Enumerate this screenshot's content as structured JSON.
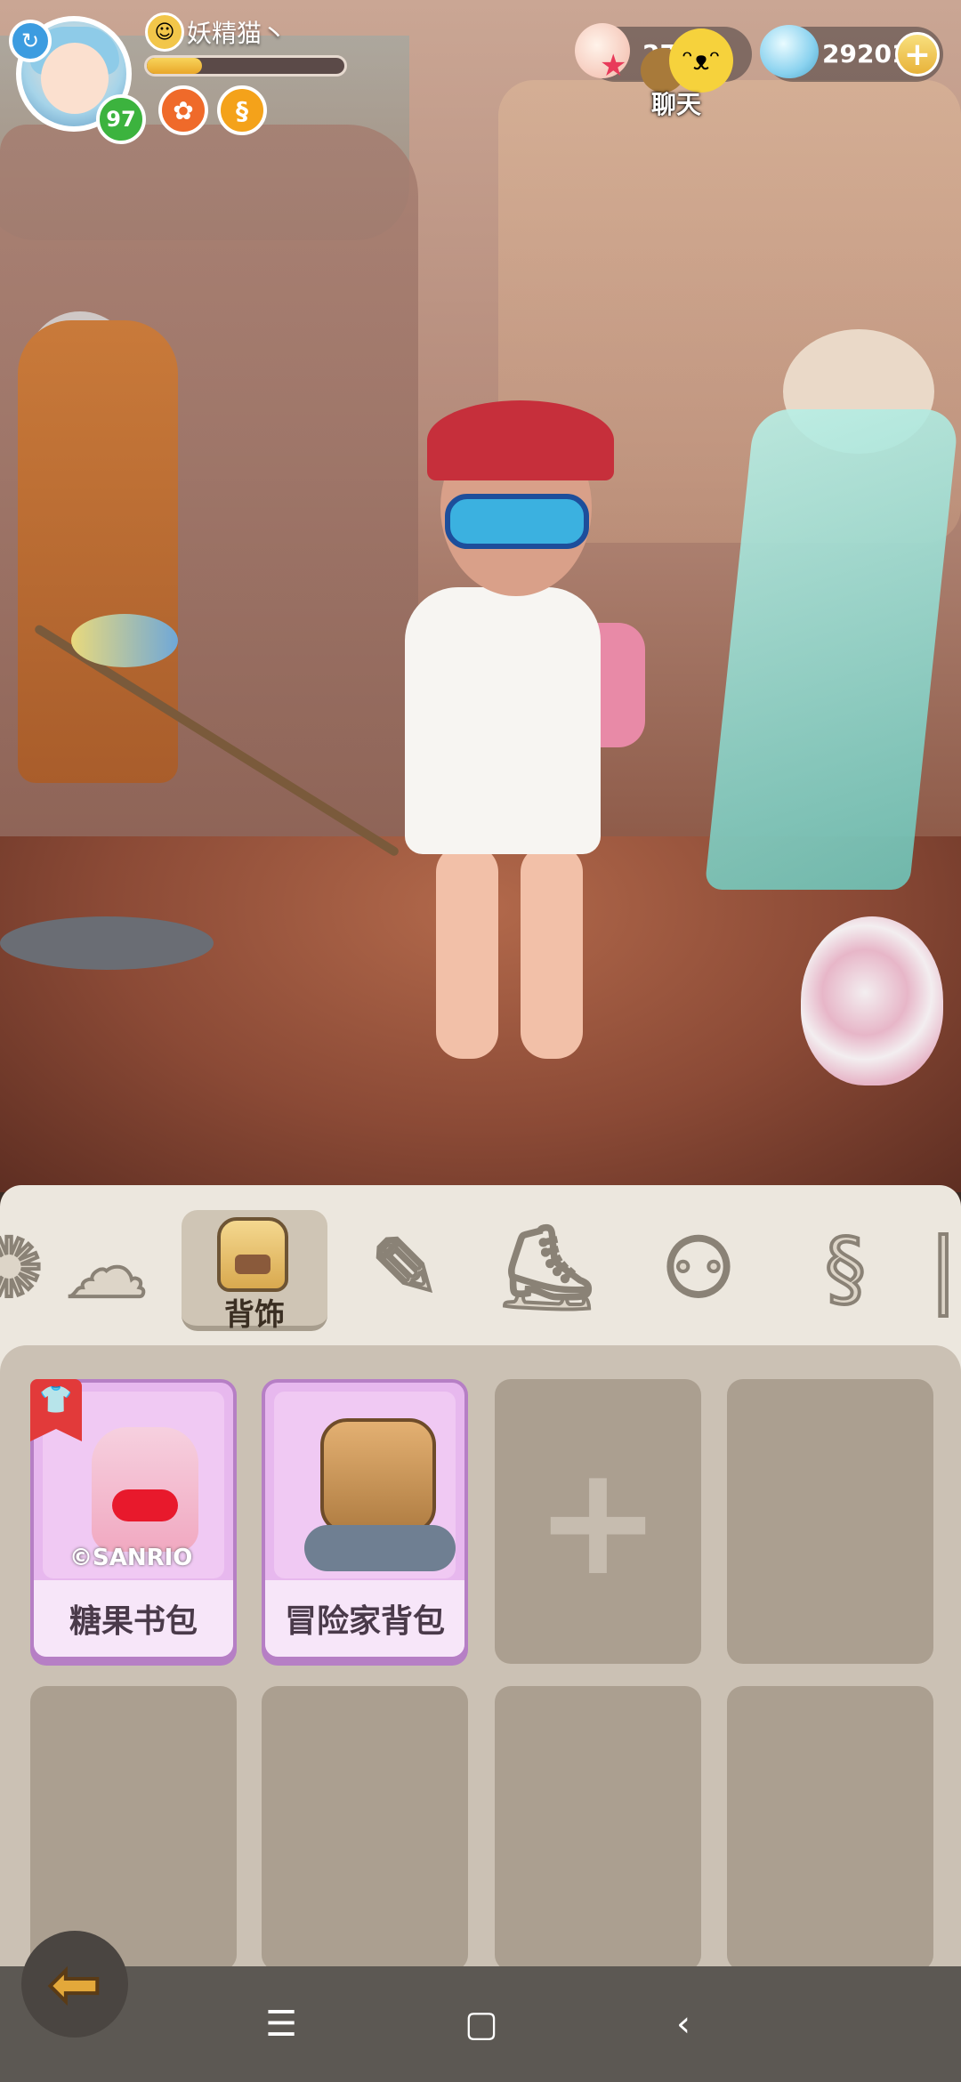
{
  "player": {
    "name": "妖精猫丶",
    "level": "97",
    "xp_fraction": 0.28
  },
  "currencies": [
    {
      "icon": "shell-icon",
      "amount": "27"
    },
    {
      "icon": "gem-icon",
      "amount": "29201"
    }
  ],
  "chat": {
    "label": "聊天"
  },
  "tabs": [
    {
      "icon": "hair-icon",
      "label": ""
    },
    {
      "icon": "backpack-icon",
      "label": "背饰",
      "selected": true
    },
    {
      "icon": "handheld-icon",
      "label": ""
    },
    {
      "icon": "shoes-icon",
      "label": ""
    },
    {
      "icon": "glasses-icon",
      "label": ""
    },
    {
      "icon": "tail-icon",
      "label": ""
    }
  ],
  "items": [
    {
      "name": "糖果书包",
      "watermark": "©SANRIO",
      "tag": "clothing-tag-icon"
    },
    {
      "name": "冒险家背包"
    }
  ],
  "colors": {
    "card_bg": "#e7b8ee",
    "card_border": "#b67fc5",
    "level_badge": "#3cb33e",
    "tag_red": "#e23a3a"
  }
}
